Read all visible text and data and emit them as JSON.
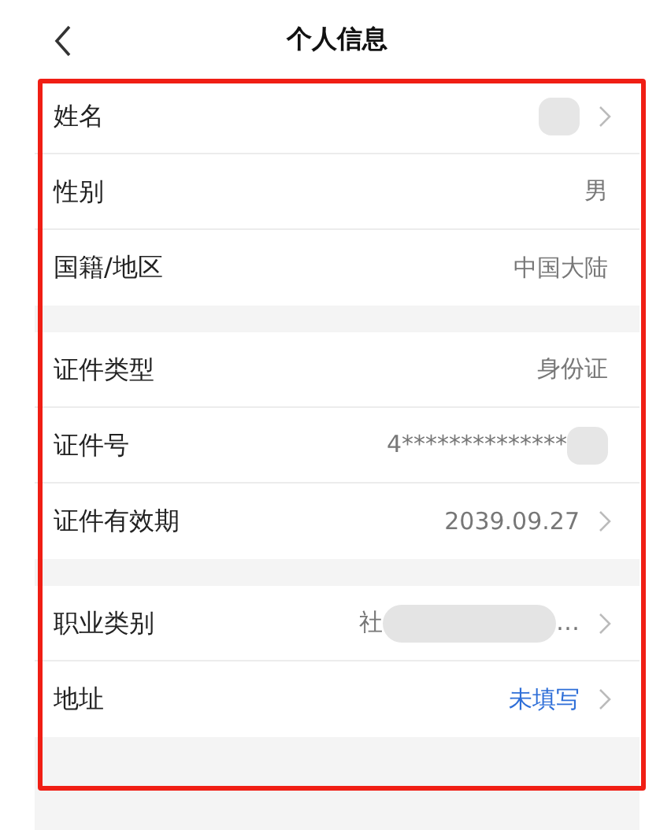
{
  "header": {
    "title": "个人信息"
  },
  "groups": [
    {
      "rows": [
        {
          "label": "姓名",
          "redacted": true,
          "chevron": true
        },
        {
          "label": "性别",
          "value": "男",
          "chevron": false
        },
        {
          "label": "国籍/地区",
          "value": "中国大陆",
          "chevron": false
        }
      ]
    },
    {
      "rows": [
        {
          "label": "证件类型",
          "value": "身份证",
          "chevron": false
        },
        {
          "label": "证件号",
          "value": "4**************",
          "redacted": true,
          "chevron": false
        },
        {
          "label": "证件有效期",
          "value": "2039.09.27",
          "chevron": true
        }
      ]
    },
    {
      "rows": [
        {
          "label": "职业类别",
          "value": "社",
          "redacted": true,
          "value_end": "…",
          "chevron": true
        },
        {
          "label": "地址",
          "value": "未填写",
          "unfilled": true,
          "chevron": true
        }
      ]
    }
  ]
}
